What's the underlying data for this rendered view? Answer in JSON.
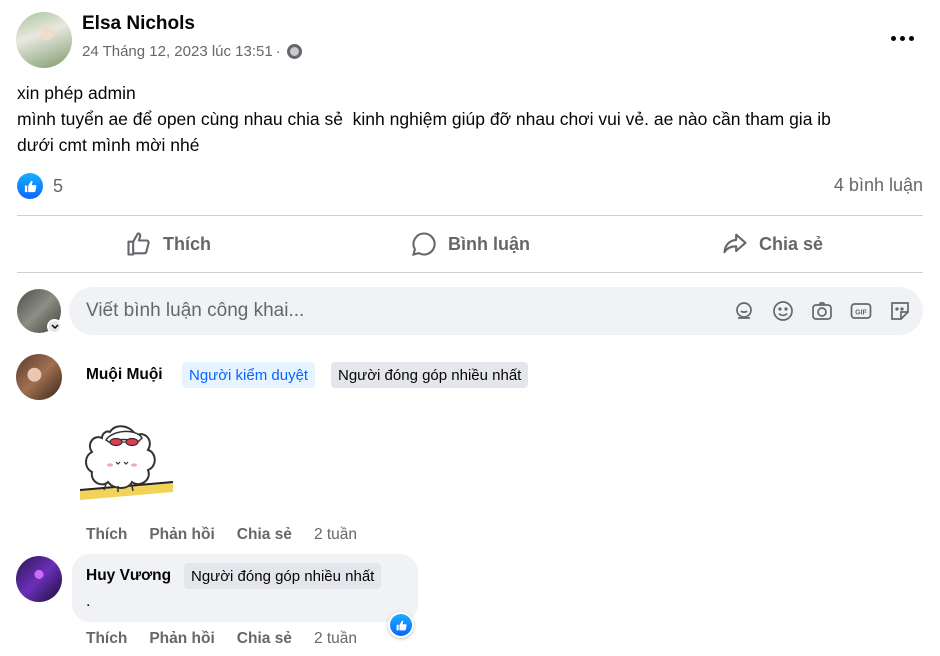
{
  "post": {
    "author": "Elsa Nichols",
    "timestamp": "24 Tháng 12, 2023 lúc 13:51",
    "meta_separator": "·",
    "privacy_icon": "globe-icon",
    "text_lines": [
      "xin phép admin",
      "mình tuyển ae để open cùng nhau chia sẻ  kinh nghiệm giúp đỡ nhau chơi vui vẻ. ae nào cần tham gia ib",
      "dưới cmt mình mời nhé"
    ],
    "reaction_count": "5",
    "comment_count": "4 bình luận"
  },
  "actions": {
    "like": "Thích",
    "comment": "Bình luận",
    "share": "Chia sẻ"
  },
  "composer": {
    "placeholder": "Viết bình luận công khai..."
  },
  "comments": [
    {
      "author": "Muội Muội",
      "badges": [
        "Người kiểm duyệt",
        "Người đóng góp nhiều nhất"
      ],
      "like_label": "Thích",
      "reply_label": "Phản hồi",
      "share_label": "Chia sẻ",
      "time": "2 tuần"
    },
    {
      "author": "Huy Vương",
      "badges": [
        "Người đóng góp nhiều nhất"
      ],
      "text": ".",
      "like_label": "Thích",
      "reply_label": "Phản hồi",
      "share_label": "Chia sẻ",
      "time": "2 tuần"
    }
  ],
  "colors": {
    "accent": "#0866ff",
    "secondary_text": "#65676b",
    "bubble": "#f0f2f5"
  }
}
